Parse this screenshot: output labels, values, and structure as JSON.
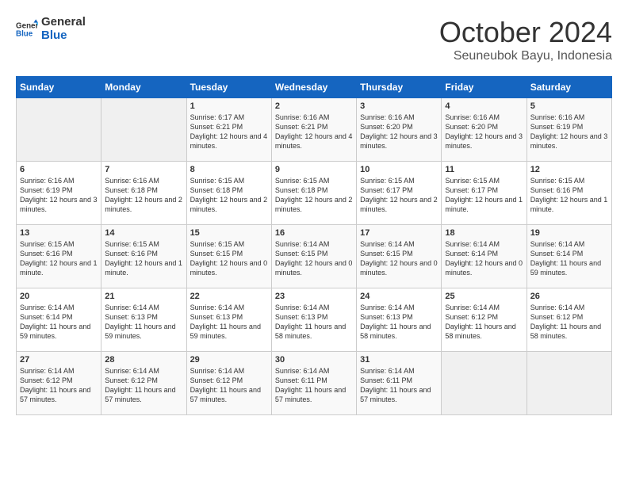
{
  "header": {
    "logo_line1": "General",
    "logo_line2": "Blue",
    "title": "October 2024",
    "subtitle": "Seuneubok Bayu, Indonesia"
  },
  "days_of_week": [
    "Sunday",
    "Monday",
    "Tuesday",
    "Wednesday",
    "Thursday",
    "Friday",
    "Saturday"
  ],
  "weeks": [
    [
      {
        "day": "",
        "info": ""
      },
      {
        "day": "",
        "info": ""
      },
      {
        "day": "1",
        "info": "Sunrise: 6:17 AM\nSunset: 6:21 PM\nDaylight: 12 hours and 4 minutes."
      },
      {
        "day": "2",
        "info": "Sunrise: 6:16 AM\nSunset: 6:21 PM\nDaylight: 12 hours and 4 minutes."
      },
      {
        "day": "3",
        "info": "Sunrise: 6:16 AM\nSunset: 6:20 PM\nDaylight: 12 hours and 3 minutes."
      },
      {
        "day": "4",
        "info": "Sunrise: 6:16 AM\nSunset: 6:20 PM\nDaylight: 12 hours and 3 minutes."
      },
      {
        "day": "5",
        "info": "Sunrise: 6:16 AM\nSunset: 6:19 PM\nDaylight: 12 hours and 3 minutes."
      }
    ],
    [
      {
        "day": "6",
        "info": "Sunrise: 6:16 AM\nSunset: 6:19 PM\nDaylight: 12 hours and 3 minutes."
      },
      {
        "day": "7",
        "info": "Sunrise: 6:16 AM\nSunset: 6:18 PM\nDaylight: 12 hours and 2 minutes."
      },
      {
        "day": "8",
        "info": "Sunrise: 6:15 AM\nSunset: 6:18 PM\nDaylight: 12 hours and 2 minutes."
      },
      {
        "day": "9",
        "info": "Sunrise: 6:15 AM\nSunset: 6:18 PM\nDaylight: 12 hours and 2 minutes."
      },
      {
        "day": "10",
        "info": "Sunrise: 6:15 AM\nSunset: 6:17 PM\nDaylight: 12 hours and 2 minutes."
      },
      {
        "day": "11",
        "info": "Sunrise: 6:15 AM\nSunset: 6:17 PM\nDaylight: 12 hours and 1 minute."
      },
      {
        "day": "12",
        "info": "Sunrise: 6:15 AM\nSunset: 6:16 PM\nDaylight: 12 hours and 1 minute."
      }
    ],
    [
      {
        "day": "13",
        "info": "Sunrise: 6:15 AM\nSunset: 6:16 PM\nDaylight: 12 hours and 1 minute."
      },
      {
        "day": "14",
        "info": "Sunrise: 6:15 AM\nSunset: 6:16 PM\nDaylight: 12 hours and 1 minute."
      },
      {
        "day": "15",
        "info": "Sunrise: 6:15 AM\nSunset: 6:15 PM\nDaylight: 12 hours and 0 minutes."
      },
      {
        "day": "16",
        "info": "Sunrise: 6:14 AM\nSunset: 6:15 PM\nDaylight: 12 hours and 0 minutes."
      },
      {
        "day": "17",
        "info": "Sunrise: 6:14 AM\nSunset: 6:15 PM\nDaylight: 12 hours and 0 minutes."
      },
      {
        "day": "18",
        "info": "Sunrise: 6:14 AM\nSunset: 6:14 PM\nDaylight: 12 hours and 0 minutes."
      },
      {
        "day": "19",
        "info": "Sunrise: 6:14 AM\nSunset: 6:14 PM\nDaylight: 11 hours and 59 minutes."
      }
    ],
    [
      {
        "day": "20",
        "info": "Sunrise: 6:14 AM\nSunset: 6:14 PM\nDaylight: 11 hours and 59 minutes."
      },
      {
        "day": "21",
        "info": "Sunrise: 6:14 AM\nSunset: 6:13 PM\nDaylight: 11 hours and 59 minutes."
      },
      {
        "day": "22",
        "info": "Sunrise: 6:14 AM\nSunset: 6:13 PM\nDaylight: 11 hours and 59 minutes."
      },
      {
        "day": "23",
        "info": "Sunrise: 6:14 AM\nSunset: 6:13 PM\nDaylight: 11 hours and 58 minutes."
      },
      {
        "day": "24",
        "info": "Sunrise: 6:14 AM\nSunset: 6:13 PM\nDaylight: 11 hours and 58 minutes."
      },
      {
        "day": "25",
        "info": "Sunrise: 6:14 AM\nSunset: 6:12 PM\nDaylight: 11 hours and 58 minutes."
      },
      {
        "day": "26",
        "info": "Sunrise: 6:14 AM\nSunset: 6:12 PM\nDaylight: 11 hours and 58 minutes."
      }
    ],
    [
      {
        "day": "27",
        "info": "Sunrise: 6:14 AM\nSunset: 6:12 PM\nDaylight: 11 hours and 57 minutes."
      },
      {
        "day": "28",
        "info": "Sunrise: 6:14 AM\nSunset: 6:12 PM\nDaylight: 11 hours and 57 minutes."
      },
      {
        "day": "29",
        "info": "Sunrise: 6:14 AM\nSunset: 6:12 PM\nDaylight: 11 hours and 57 minutes."
      },
      {
        "day": "30",
        "info": "Sunrise: 6:14 AM\nSunset: 6:11 PM\nDaylight: 11 hours and 57 minutes."
      },
      {
        "day": "31",
        "info": "Sunrise: 6:14 AM\nSunset: 6:11 PM\nDaylight: 11 hours and 57 minutes."
      },
      {
        "day": "",
        "info": ""
      },
      {
        "day": "",
        "info": ""
      }
    ]
  ]
}
